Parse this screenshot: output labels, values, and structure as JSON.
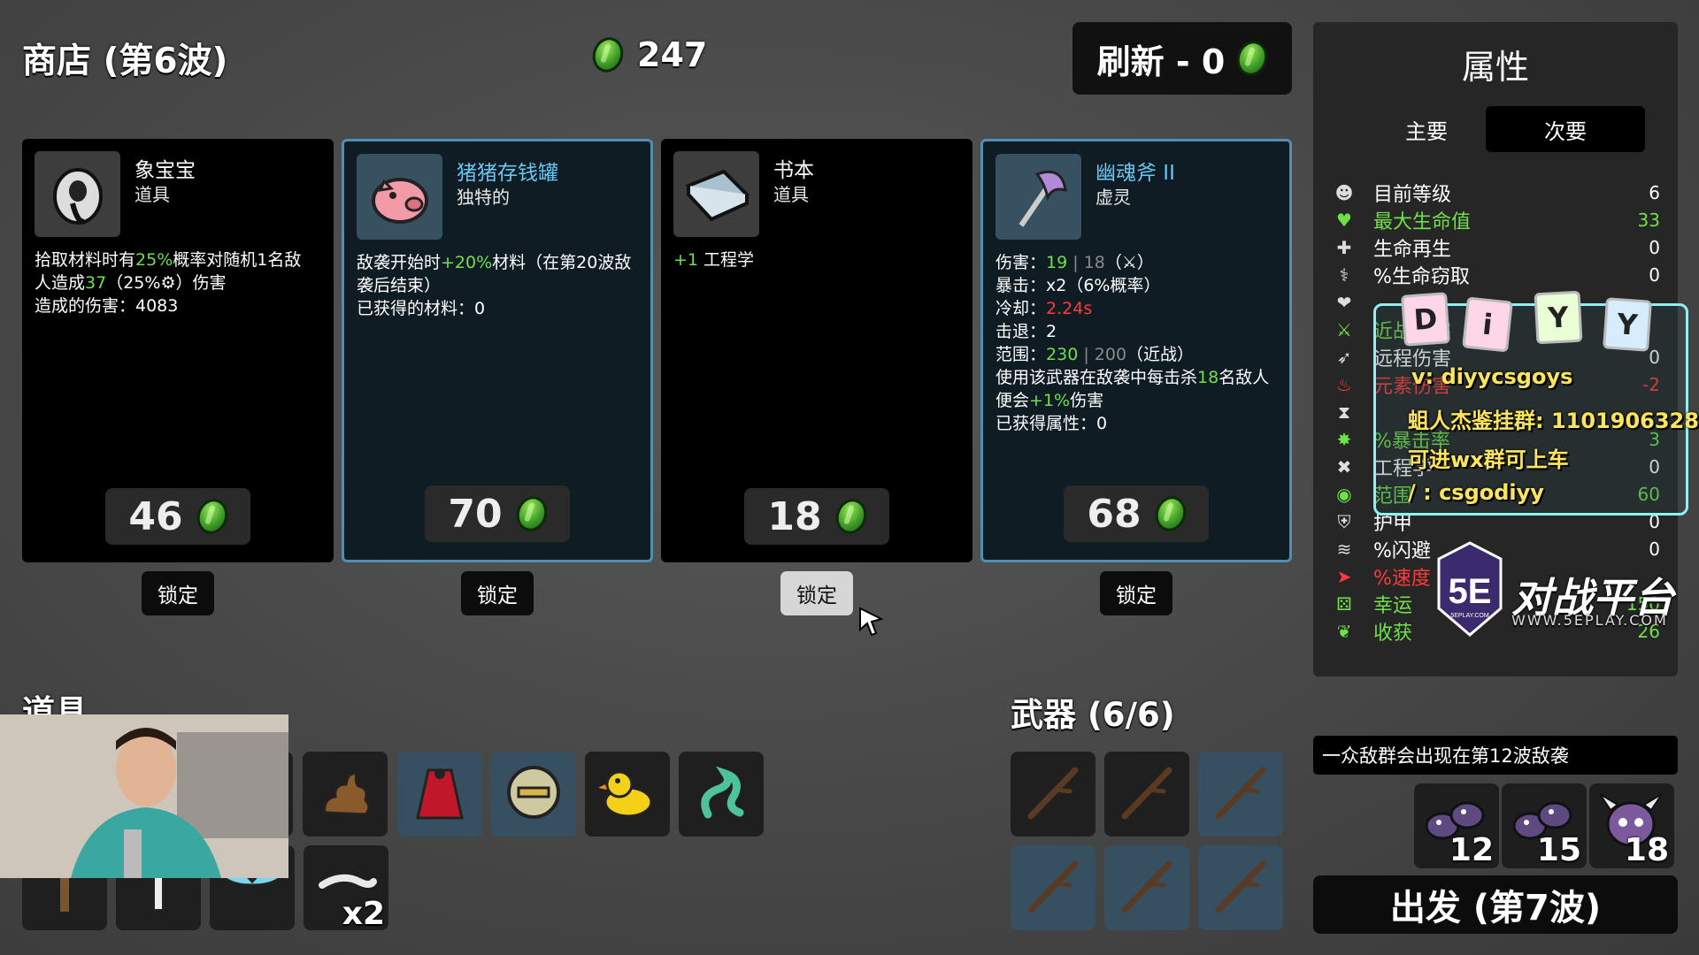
{
  "header": {
    "shop_title": "商店 (第6波)",
    "gold": "247",
    "reroll_label": "刷新 - 0"
  },
  "shop": [
    {
      "name": "象宝宝",
      "type": "道具",
      "icon": "baby-elephant-icon",
      "rarity": "common",
      "desc": [
        {
          "parts": [
            {
              "t": "拾取材料时有"
            },
            {
              "t": "25%",
              "c": "green"
            },
            {
              "t": "概率对随机1名敌"
            }
          ]
        },
        {
          "parts": [
            {
              "t": "人造成"
            },
            {
              "t": "37",
              "c": "green"
            },
            {
              "t": "（25%"
            },
            {
              "t": "⚙",
              "c": "white"
            },
            {
              "t": "）伤害"
            }
          ]
        },
        {
          "parts": [
            {
              "t": "造成的伤害：4083"
            }
          ]
        }
      ],
      "price": "46",
      "lock_label": "锁定",
      "locked": false
    },
    {
      "name": "猪猪存钱罐",
      "type": "独特的",
      "icon": "piggy-bank-icon",
      "rarity": "blue",
      "desc": [
        {
          "parts": [
            {
              "t": "敌袭开始时"
            },
            {
              "t": "+20%",
              "c": "green"
            },
            {
              "t": "材料（在第20波敌"
            }
          ]
        },
        {
          "parts": [
            {
              "t": "袭后结束）"
            }
          ]
        },
        {
          "parts": [
            {
              "t": "已获得的材料：0"
            }
          ]
        }
      ],
      "price": "70",
      "lock_label": "锁定",
      "locked": false
    },
    {
      "name": "书本",
      "type": "道具",
      "icon": "book-icon",
      "rarity": "common",
      "desc": [
        {
          "parts": [
            {
              "t": "+1",
              "c": "green"
            },
            {
              "t": " 工程学"
            }
          ]
        }
      ],
      "price": "18",
      "lock_label": "锁定",
      "locked": true
    },
    {
      "name": "幽魂斧 II",
      "type": "虚灵",
      "icon": "ghost-axe-icon",
      "rarity": "blue",
      "desc": [
        {
          "parts": [
            {
              "t": "伤害："
            },
            {
              "t": "19",
              "c": "green"
            },
            {
              "t": " | 18",
              "c": "gray"
            },
            {
              "t": "（⚔）"
            }
          ]
        },
        {
          "parts": [
            {
              "t": "暴击：x2（6%概率）"
            }
          ]
        },
        {
          "parts": [
            {
              "t": "冷却："
            },
            {
              "t": "2.24s",
              "c": "red"
            }
          ]
        },
        {
          "parts": [
            {
              "t": "击退：2"
            }
          ]
        },
        {
          "parts": [
            {
              "t": "范围："
            },
            {
              "t": "230",
              "c": "green"
            },
            {
              "t": " | 200",
              "c": "gray"
            },
            {
              "t": "（近战）"
            }
          ]
        },
        {
          "parts": [
            {
              "t": "使用该武器在敌袭中每击杀"
            },
            {
              "t": "18",
              "c": "green"
            },
            {
              "t": "名敌人"
            }
          ]
        },
        {
          "parts": [
            {
              "t": "便会"
            },
            {
              "t": "+1%",
              "c": "green"
            },
            {
              "t": "伤害"
            }
          ]
        },
        {
          "parts": [
            {
              "t": "已获得属性：0"
            }
          ]
        }
      ],
      "price": "68",
      "lock_label": "锁定",
      "locked": false
    }
  ],
  "items_title": "道具",
  "items": [
    {
      "icon": "hidden-item-icon",
      "rarity": "common"
    },
    {
      "icon": "poop-icon",
      "rarity": "common"
    },
    {
      "icon": "red-cape-icon",
      "rarity": "blue"
    },
    {
      "icon": "helmet-icon",
      "rarity": "blue"
    },
    {
      "icon": "rubber-duck-icon",
      "rarity": "common"
    },
    {
      "icon": "green-tentacle-icon",
      "rarity": "common"
    },
    {
      "icon": "tree-icon",
      "rarity": "common"
    },
    {
      "icon": "mushroom-icon",
      "rarity": "common"
    },
    {
      "icon": "wings-icon",
      "rarity": "common"
    },
    {
      "icon": "lizard-icon",
      "rarity": "common",
      "count": "x2"
    }
  ],
  "weapons_title": "武器 (6/6)",
  "weapons": [
    {
      "icon": "stick-icon",
      "rarity": "common"
    },
    {
      "icon": "stick-icon",
      "rarity": "common"
    },
    {
      "icon": "stick-icon",
      "rarity": "blue"
    },
    {
      "icon": "stick-icon",
      "rarity": "blue"
    },
    {
      "icon": "stick-icon",
      "rarity": "blue"
    },
    {
      "icon": "stick-icon",
      "rarity": "blue"
    }
  ],
  "stats": {
    "title": "属性",
    "tab_primary": "主要",
    "tab_secondary": "次要",
    "rows": [
      {
        "icon": "level-icon",
        "label": "目前等级",
        "value": "6",
        "c": "white"
      },
      {
        "icon": "heart-icon",
        "label": "最大生命值",
        "value": "33",
        "c": "green"
      },
      {
        "icon": "regen-icon",
        "label": "生命再生",
        "value": "0",
        "c": "white"
      },
      {
        "icon": "lifesteal-icon",
        "label": "%生命窃取",
        "value": "0",
        "c": "white"
      },
      {
        "icon": "damage-icon",
        "label": "",
        "value": "",
        "c": "white"
      },
      {
        "icon": "melee-icon",
        "label": "近战伤害",
        "value": "",
        "c": "green"
      },
      {
        "icon": "ranged-icon",
        "label": "远程伤害",
        "value": "0",
        "c": "white"
      },
      {
        "icon": "elemental-icon",
        "label": "元素伤害",
        "value": "-2",
        "c": "red"
      },
      {
        "icon": "attack-speed-icon",
        "label": "",
        "value": "",
        "c": "white"
      },
      {
        "icon": "crit-icon",
        "label": "%暴击率",
        "value": "3",
        "c": "green"
      },
      {
        "icon": "engineering-icon",
        "label": "工程学",
        "value": "0",
        "c": "white"
      },
      {
        "icon": "range-icon",
        "label": "范围",
        "value": "60",
        "c": "green"
      },
      {
        "icon": "armor-icon",
        "label": "护甲",
        "value": "0",
        "c": "white"
      },
      {
        "icon": "dodge-icon",
        "label": "%闪避",
        "value": "0",
        "c": "white"
      },
      {
        "icon": "speed-icon",
        "label": "%速度",
        "value": "",
        "c": "red"
      },
      {
        "icon": "luck-icon",
        "label": "幸运",
        "value": "150",
        "c": "green"
      },
      {
        "icon": "harvest-icon",
        "label": "收获",
        "value": "26",
        "c": "green"
      }
    ]
  },
  "overlay": {
    "tags": [
      "D",
      "i",
      "Y",
      "Y"
    ],
    "lines": [
      "v: diyycsgoys",
      "蛆人杰鉴挂群: 1101906328",
      "可进wx群可上车",
      "/ : csgodiyy"
    ],
    "logo_mark": "5E",
    "logo_sub": "5EPLAY.COM",
    "logo_text": "对战平台",
    "logo_url": "WWW.5EPLAY.COM"
  },
  "wave_message": "一众敌群会出现在第12波敌袭",
  "enemies": [
    {
      "icon": "bug-enemy-icon",
      "count": "12"
    },
    {
      "icon": "bug-enemy-icon",
      "count": "15"
    },
    {
      "icon": "horned-enemy-icon",
      "count": "18"
    }
  ],
  "go_label": "出发 (第7波)"
}
